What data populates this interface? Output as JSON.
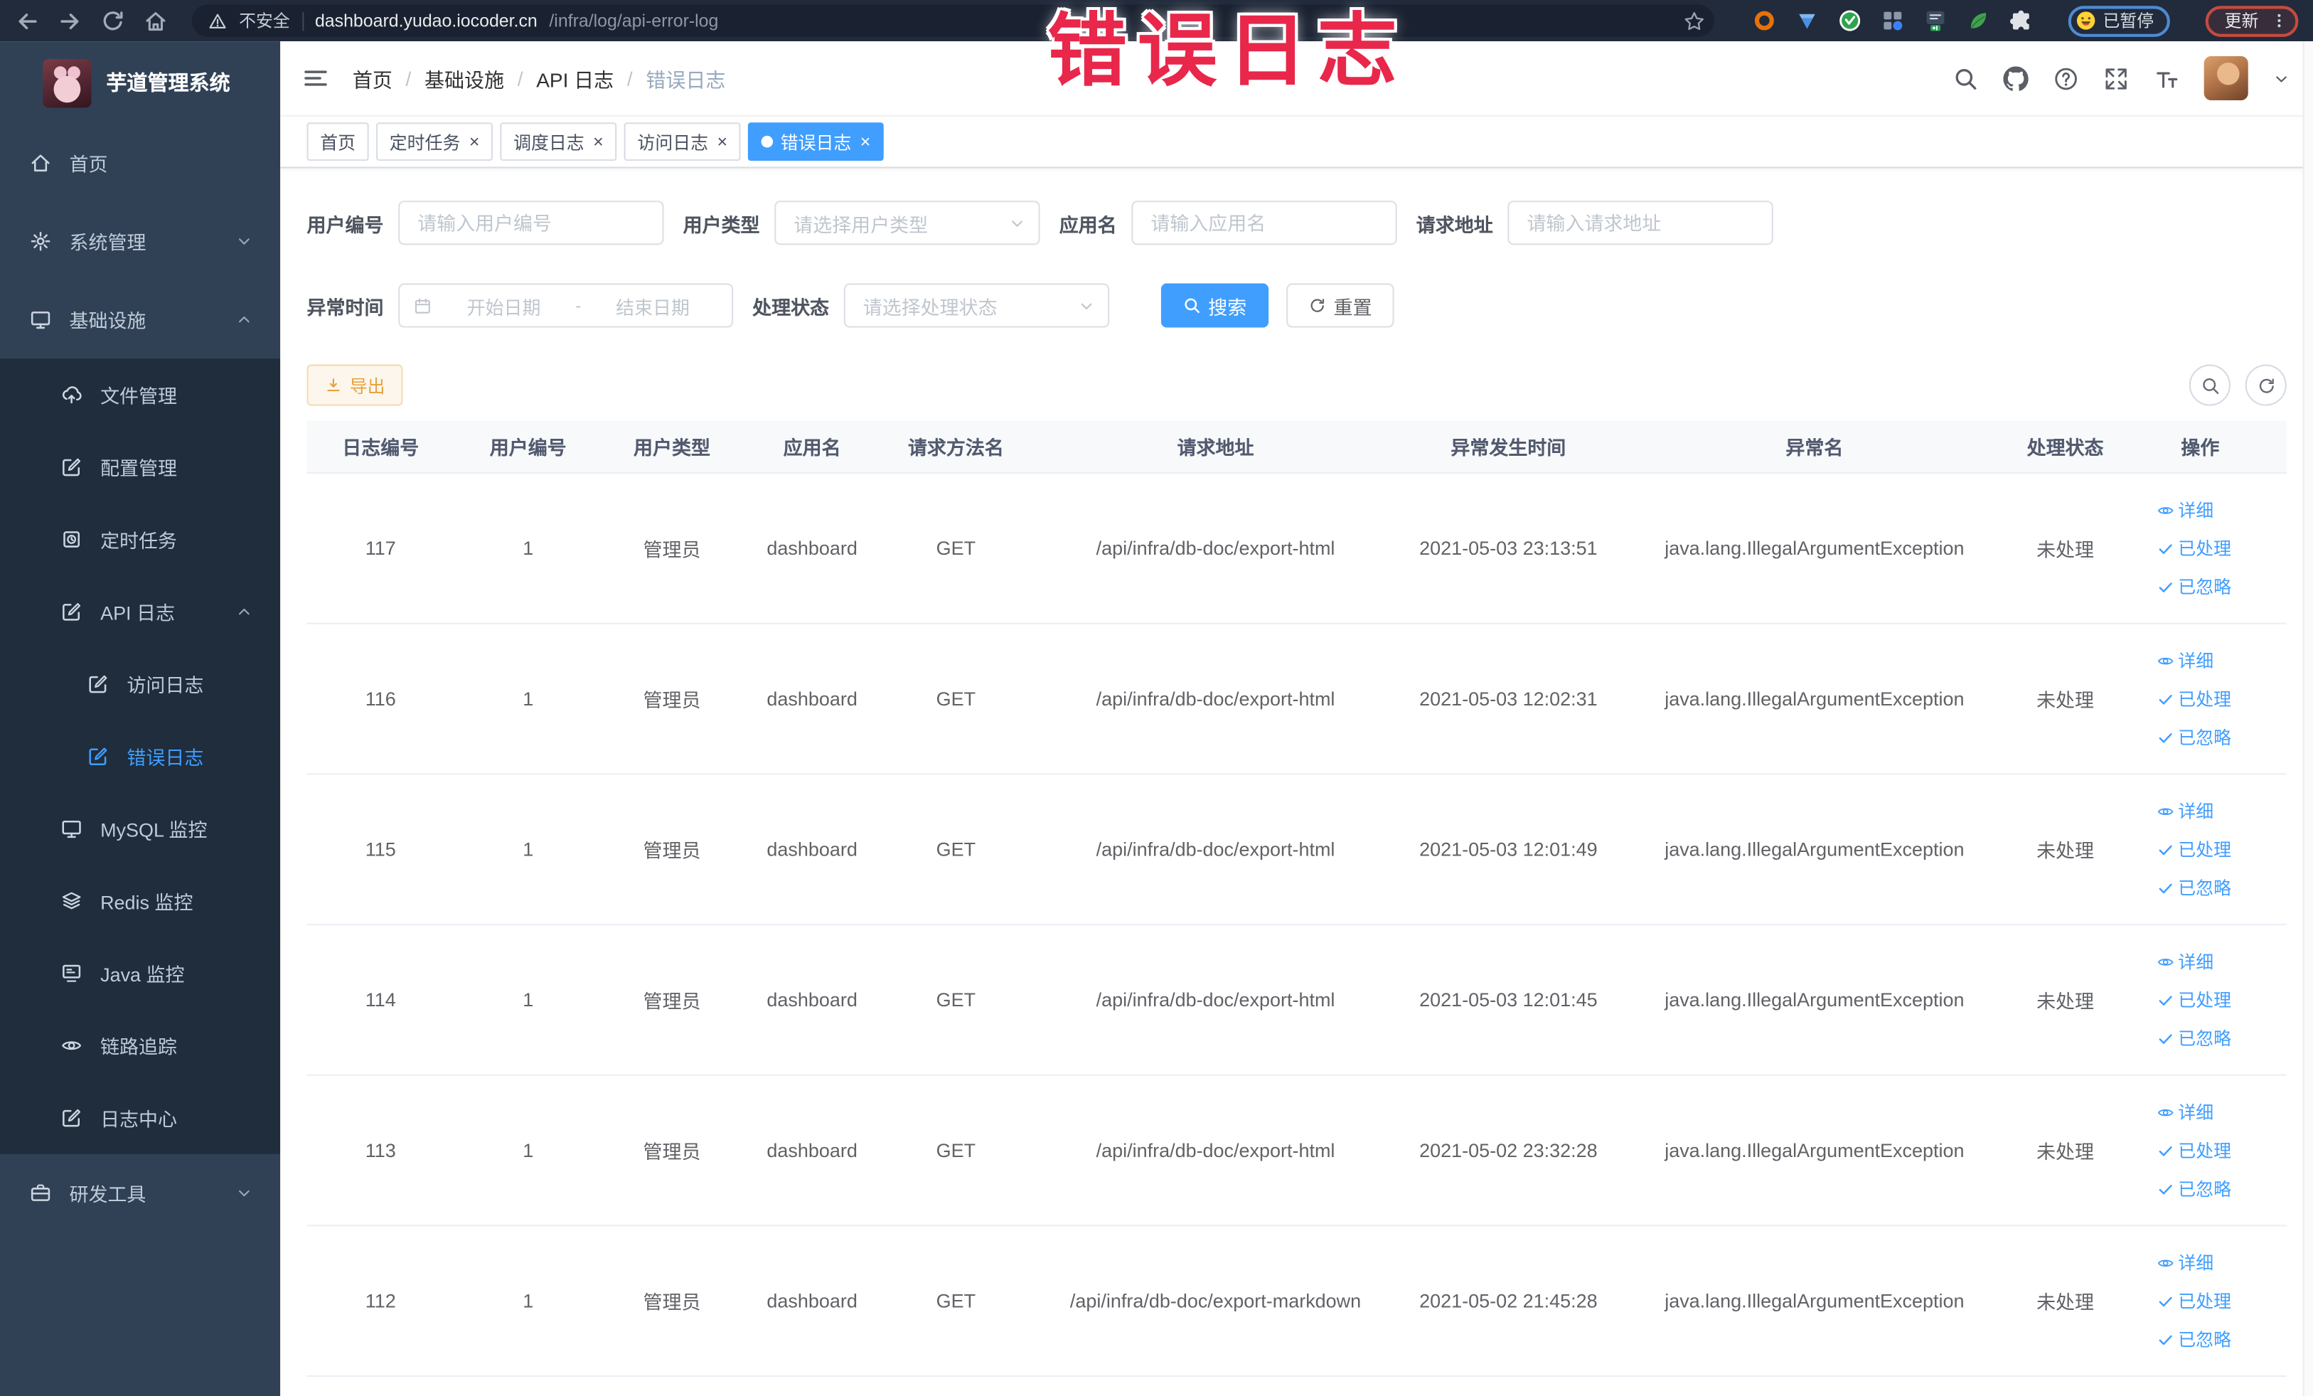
{
  "colors": {
    "accent_blue": "#409eff",
    "warning_orange": "#e6a23c",
    "annotation_red": "#e8274b",
    "sidebar_bg": "#304156",
    "sidebar_submenu_bg": "#1f2d3d",
    "chrome_bar_bg": "#212b3b"
  },
  "browser": {
    "security_label": "不安全",
    "url_host": "dashboard.yudao.iocoder.cn",
    "url_path": "/infra/log/api-error-log",
    "profile_chip_label": "已暂停",
    "update_button_label": "更新",
    "extension_icons": [
      "target-orange",
      "shield-blue",
      "circle-green",
      "grid-blue",
      "switch-dark-on",
      "leaf-green",
      "puzzle-white"
    ]
  },
  "annotation": {
    "text": "错误日志"
  },
  "sidebar": {
    "logo_title": "芋道管理系统",
    "items": [
      {
        "name": "home",
        "label": "首页",
        "icon": "home2",
        "level": 1,
        "zone": "root"
      },
      {
        "name": "system-management",
        "label": "系统管理",
        "icon": "gear",
        "level": 1,
        "zone": "root",
        "chevron": "down"
      },
      {
        "name": "infrastructure",
        "label": "基础设施",
        "icon": "monitor",
        "level": 1,
        "zone": "root",
        "chevron": "up"
      },
      {
        "name": "file-management",
        "label": "文件管理",
        "icon": "upload-cloud",
        "level": 2,
        "zone": "sub"
      },
      {
        "name": "config-management",
        "label": "配置管理",
        "icon": "edit",
        "level": 2,
        "zone": "sub"
      },
      {
        "name": "scheduled-tasks",
        "label": "定时任务",
        "icon": "task",
        "level": 2,
        "zone": "sub"
      },
      {
        "name": "api-log",
        "label": "API 日志",
        "icon": "edit",
        "level": 2,
        "zone": "sub",
        "chevron": "up"
      },
      {
        "name": "access-log",
        "label": "访问日志",
        "icon": "edit",
        "level": 3,
        "zone": "sub"
      },
      {
        "name": "error-log",
        "label": "错误日志",
        "icon": "edit",
        "level": 3,
        "zone": "sub",
        "active": true
      },
      {
        "name": "mysql-monitor",
        "label": "MySQL 监控",
        "icon": "monitor",
        "level": 2,
        "zone": "sub"
      },
      {
        "name": "redis-monitor",
        "label": "Redis 监控",
        "icon": "layers",
        "level": 2,
        "zone": "sub"
      },
      {
        "name": "java-monitor",
        "label": "Java 监控",
        "icon": "java",
        "level": 2,
        "zone": "sub"
      },
      {
        "name": "trace",
        "label": "链路追踪",
        "icon": "eye",
        "level": 2,
        "zone": "sub"
      },
      {
        "name": "log-center",
        "label": "日志中心",
        "icon": "edit",
        "level": 2,
        "zone": "sub"
      },
      {
        "name": "dev-tools",
        "label": "研发工具",
        "icon": "briefcase",
        "level": 1,
        "zone": "root",
        "chevron": "down"
      }
    ]
  },
  "navbar": {
    "breadcrumb": [
      "首页",
      "基础设施",
      "API 日志",
      "错误日志"
    ],
    "separator": "/",
    "right_icons": [
      "search",
      "github",
      "question",
      "fullscreen",
      "font-size"
    ]
  },
  "tabs": [
    {
      "name": "home",
      "label": "首页",
      "closable": false,
      "active": false
    },
    {
      "name": "job",
      "label": "定时任务",
      "closable": true,
      "active": false
    },
    {
      "name": "job-log",
      "label": "调度日志",
      "closable": true,
      "active": false
    },
    {
      "name": "access-log",
      "label": "访问日志",
      "closable": true,
      "active": false
    },
    {
      "name": "error-log",
      "label": "错误日志",
      "closable": true,
      "active": true
    }
  ],
  "filters": {
    "user_id_label": "用户编号",
    "user_id_placeholder": "请输入用户编号",
    "user_type_label": "用户类型",
    "user_type_placeholder": "请选择用户类型",
    "app_name_label": "应用名",
    "app_name_placeholder": "请输入应用名",
    "request_url_label": "请求地址",
    "request_url_placeholder": "请输入请求地址",
    "exception_time_label": "异常时间",
    "start_date_placeholder": "开始日期",
    "date_separator": "-",
    "end_date_placeholder": "结束日期",
    "process_status_label": "处理状态",
    "process_status_placeholder": "请选择处理状态",
    "search_button": "搜索",
    "reset_button": "重置"
  },
  "toolbar": {
    "export_button": "导出"
  },
  "table": {
    "columns": [
      "日志编号",
      "用户编号",
      "用户类型",
      "应用名",
      "请求方法名",
      "请求地址",
      "异常发生时间",
      "异常名",
      "处理状态",
      "操作"
    ],
    "actions": [
      {
        "name": "detail",
        "icon": "eye",
        "label": "详细"
      },
      {
        "name": "mark-processed",
        "icon": "check",
        "label": "已处理"
      },
      {
        "name": "mark-ignored",
        "icon": "check",
        "label": "已忽略"
      }
    ],
    "rows": [
      {
        "log_id": "117",
        "user_id": "1",
        "user_type": "管理员",
        "app_name": "dashboard",
        "method": "GET",
        "url": "/api/infra/db-doc/export-html",
        "time": "2021-05-03 23:13:51",
        "exception": "java.lang.IllegalArgumentException",
        "status": "未处理"
      },
      {
        "log_id": "116",
        "user_id": "1",
        "user_type": "管理员",
        "app_name": "dashboard",
        "method": "GET",
        "url": "/api/infra/db-doc/export-html",
        "time": "2021-05-03 12:02:31",
        "exception": "java.lang.IllegalArgumentException",
        "status": "未处理"
      },
      {
        "log_id": "115",
        "user_id": "1",
        "user_type": "管理员",
        "app_name": "dashboard",
        "method": "GET",
        "url": "/api/infra/db-doc/export-html",
        "time": "2021-05-03 12:01:49",
        "exception": "java.lang.IllegalArgumentException",
        "status": "未处理"
      },
      {
        "log_id": "114",
        "user_id": "1",
        "user_type": "管理员",
        "app_name": "dashboard",
        "method": "GET",
        "url": "/api/infra/db-doc/export-html",
        "time": "2021-05-03 12:01:45",
        "exception": "java.lang.IllegalArgumentException",
        "status": "未处理"
      },
      {
        "log_id": "113",
        "user_id": "1",
        "user_type": "管理员",
        "app_name": "dashboard",
        "method": "GET",
        "url": "/api/infra/db-doc/export-html",
        "time": "2021-05-02 23:32:28",
        "exception": "java.lang.IllegalArgumentException",
        "status": "未处理"
      },
      {
        "log_id": "112",
        "user_id": "1",
        "user_type": "管理员",
        "app_name": "dashboard",
        "method": "GET",
        "url": "/api/infra/db-doc/export-markdown",
        "time": "2021-05-02 21:45:28",
        "exception": "java.lang.IllegalArgumentException",
        "status": "未处理"
      }
    ]
  }
}
